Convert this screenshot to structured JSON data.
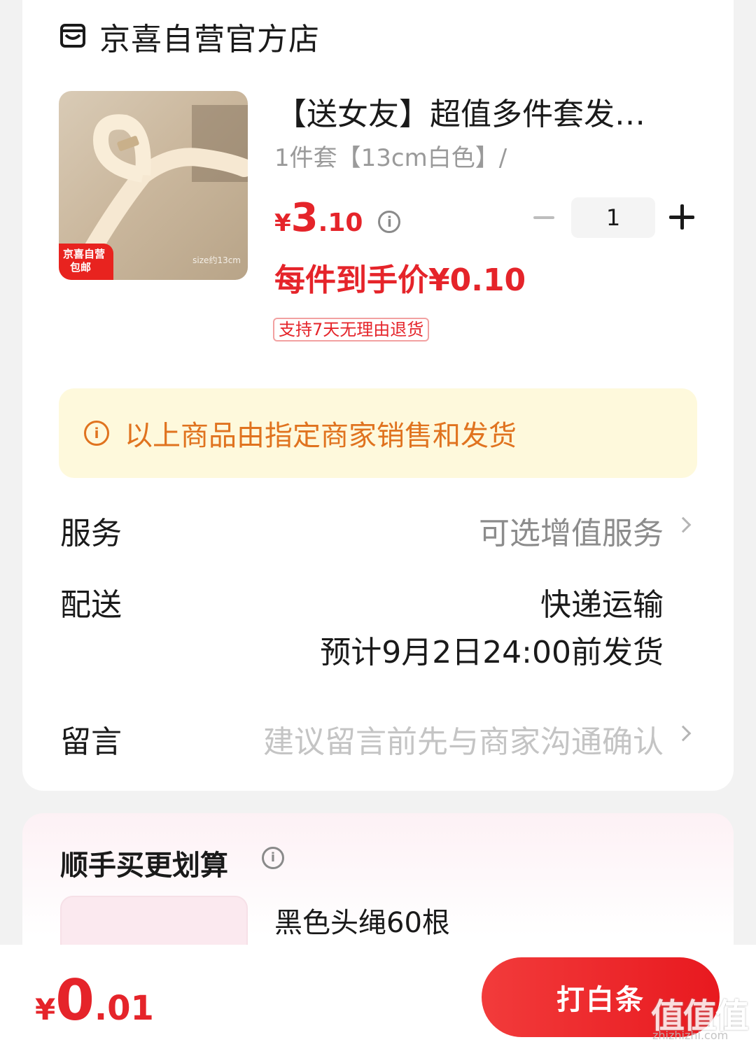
{
  "shop": {
    "name": "京喜自营官方店",
    "icon": "store-icon"
  },
  "product": {
    "thumbnail_badge": [
      "京喜自营",
      "包邮"
    ],
    "thumbnail_size_text": "size约13cm",
    "title": "【送女友】超值多件套发…",
    "spec": "1件套【13cm白色】/",
    "price": {
      "currency": "¥",
      "integer": "3",
      "decimal": ".10"
    },
    "quantity": "1",
    "deal_price": "每件到手价¥0.10",
    "return_tag": "支持7天无理由退货"
  },
  "notice": {
    "text": "以上商品由指定商家销售和发货",
    "icon": "info-icon"
  },
  "service": {
    "label": "服务",
    "value": "可选增值服务"
  },
  "delivery": {
    "label": "配送",
    "method": "快递运输",
    "eta": "预计9月2日24:00前发货"
  },
  "message": {
    "label": "留言",
    "placeholder": "建议留言前先与商家沟通确认"
  },
  "upsell": {
    "title": "顺手买更划算",
    "item_name": "黑色头绳60根"
  },
  "footer": {
    "total": {
      "currency": "¥",
      "integer": "0",
      "decimal": ".01"
    },
    "pay_label": "打白条"
  },
  "watermark": {
    "big": "值值值",
    "small": "zhizhizhi.com"
  },
  "colors": {
    "accent_red": "#e5242a",
    "notice_bg": "#fef9dc",
    "notice_text": "#e0731f"
  }
}
